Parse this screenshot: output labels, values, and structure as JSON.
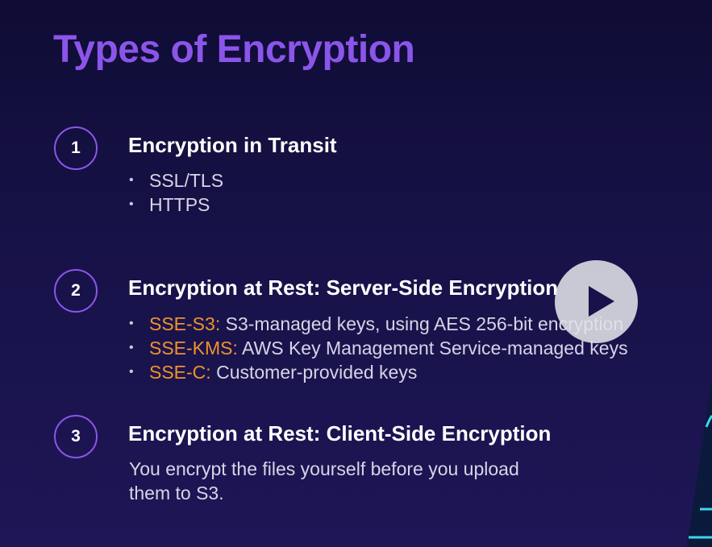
{
  "title": "Types of Encryption",
  "sections": [
    {
      "number": "1",
      "heading": "Encryption in Transit",
      "bullets": [
        {
          "key": "",
          "text": "SSL/TLS"
        },
        {
          "key": "",
          "text": "HTTPS"
        }
      ]
    },
    {
      "number": "2",
      "heading": "Encryption at Rest: Server-Side Encryption",
      "bullets": [
        {
          "key": "SSE-S3:",
          "text": " S3-managed keys, using AES 256-bit encryption"
        },
        {
          "key": "SSE-KMS:",
          "text": " AWS Key Management Service-managed keys"
        },
        {
          "key": "SSE-C:",
          "text": " Customer-provided keys"
        }
      ]
    },
    {
      "number": "3",
      "heading": "Encryption at Rest: Client-Side Encryption",
      "description": "You encrypt the files yourself before you upload them to S3."
    }
  ],
  "video": {
    "play_icon": "play-icon"
  },
  "colors": {
    "title": "#8b55ea",
    "key": "#f0922e",
    "accent_line": "#3fd6ea"
  }
}
